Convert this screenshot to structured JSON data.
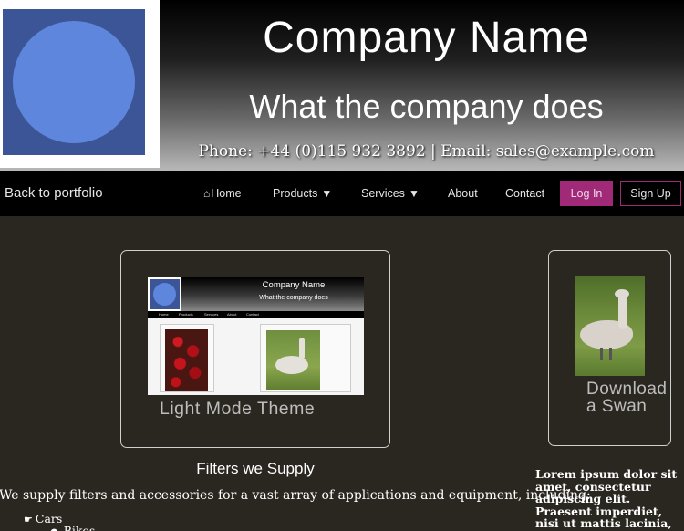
{
  "header": {
    "company_name": "Company Name",
    "tagline": "What the company does",
    "contact_line": "Phone: +44 (0)115 932 3892 | Email: sales@example.com"
  },
  "nav": {
    "back": "Back to portfolio",
    "home": "Home",
    "products": "Products",
    "services": "Services",
    "about": "About",
    "contact": "Contact",
    "login": "Log In",
    "signup": "Sign Up",
    "dropdown_caret": "▼",
    "home_icon": "home-icon"
  },
  "cards": {
    "light_mode": {
      "label": "Light Mode Theme"
    },
    "swan": {
      "label": "Download a Swan"
    }
  },
  "mini_preview": {
    "title": "Company Name",
    "tagline": "What the company does",
    "nav": [
      "Home",
      "Products",
      "Services",
      "About",
      "Contact"
    ]
  },
  "filters": {
    "title": "Filters we Supply",
    "intro": "We supply filters and accessories for a vast array of applications and equipment, including:",
    "items": [
      "Cars",
      "Bikes"
    ]
  },
  "sidebar_text": "Lorem ipsum dolor sit amet, consectetur adipiscing elit. Praesent imperdiet, nisi ut mattis lacinia, ligula libero",
  "colors": {
    "accent": "#a02a78",
    "logo_bg": "#3b5597",
    "logo_circle": "#5d86dc",
    "page_bg": "#2a2620"
  }
}
